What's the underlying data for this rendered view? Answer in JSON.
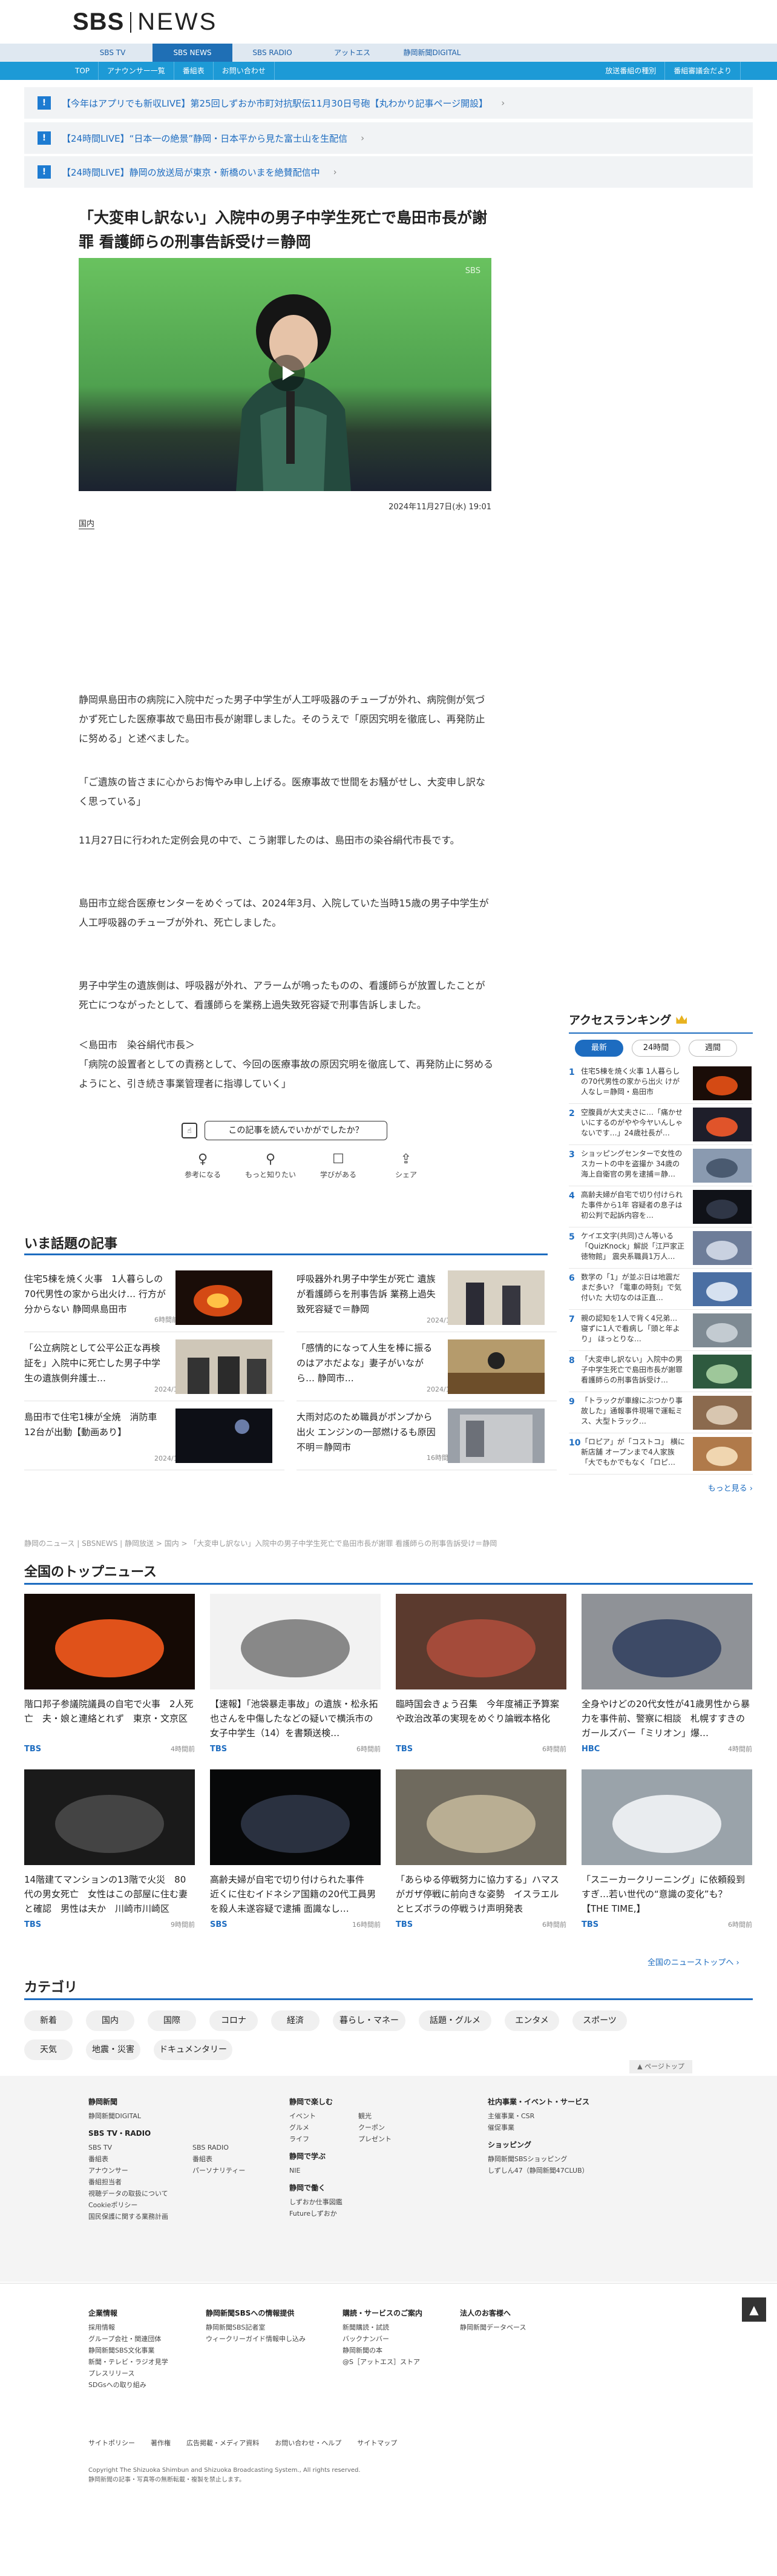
{
  "logo": {
    "sbs": "SBS",
    "news": "NEWS"
  },
  "nav1": [
    "SBS TV",
    "SBS NEWS",
    "SBS RADIO",
    "アットエス",
    "静岡新聞DIGITAL"
  ],
  "nav2_left": [
    "TOP",
    "アナウンサー一覧",
    "番組表",
    "お問い合わせ"
  ],
  "nav2_right": [
    "放送番組の種別",
    "番組審議会だより"
  ],
  "alerts": [
    "【今年はアプリでも新収LIVE】第25回しずおか市町対抗駅伝11月30日号砲【丸わかり記事ページ開設】",
    "【24時間LIVE】“日本一の絶景”静岡・日本平から見た富士山を生配信",
    "【24時間LIVE】静岡の放送局が東京・新橋のいまを絶賛配信中"
  ],
  "article": {
    "title": "「大変申し訳ない」入院中の男子中学生死亡で島田市長が謝罪 看護師らの刑事告訴受け＝静岡",
    "video_mark": "SBS",
    "date": "2024年11月27日(水) 19:01",
    "category": "国内",
    "paragraphs": [
      "静岡県島田市の病院に入院中だった男子中学生が人工呼吸器のチューブが外れ、病院側が気づかず死亡した医療事故で島田市長が謝罪しました。そのうえで「原因究明を徹底し、再発防止に努める」と述べました。",
      "「ご遺族の皆さまに心からお悔やみ申し上げる。医療事故で世間をお騒がせし、大変申し訳なく思っている」",
      "11月27日に行われた定例会見の中で、こう謝罪したのは、島田市の染谷絹代市長です。",
      "島田市立総合医療センターをめぐっては、2024年3月、入院していた当時15歳の男子中学生が人工呼吸器のチューブが外れ、死亡しました。",
      "男子中学生の遺族側は、呼吸器が外れ、アラームが鳴ったものの、看護師らが放置したことが死亡につながったとして、看護師らを業務上過失致死容疑で刑事告訴しました。",
      "＜島田市　染谷絹代市長＞",
      "「病院の設置者としての責務として、今回の医療事故の原因究明を徹底して、再発防止に努めるようにと、引き続き事業管理者に指導していく」"
    ],
    "reaction_question": "この記事を読んでいかがでしたか？",
    "reactions": [
      "参考になる",
      "もっと知りたい",
      "学びがある",
      "シェア"
    ]
  },
  "hot": {
    "title": "いま話題の記事",
    "items": [
      {
        "title": "住宅5棟を焼く火事　1人暮らしの70代男性の家から出火け… 行方が分からない 静岡県島田市",
        "time": "6時間前"
      },
      {
        "title": "呼吸器外れ男子中学生が死亡 遺族が看護師らを刑事告訴 業務上過失致死容疑で＝静岡",
        "time": "2024/11/26"
      },
      {
        "title": "「公立病院として公平公正な再検証を」入院中に死亡した男子中学生の遺族側弁護士…",
        "time": "2024/11/18"
      },
      {
        "title": "「感情的になって人生を棒に振るのはアホだよな」妻子がいながら… 静岡市…",
        "time": "2024/10/10"
      },
      {
        "title": "島田市で住宅1棟が全焼　消防車12台が出動【動画あり】",
        "time": "2024/11/10"
      },
      {
        "title": "大雨対応のため職員がポンプから出火 エンジンの一部燃けるも原因不明＝静岡市",
        "time": "16時間前"
      }
    ]
  },
  "breadcrumb": "静岡のニュース | SBSNEWS | 静岡放送 > 国内 > 「大変申し訳ない」入院中の男子中学生死亡で島田市長が謝罪 看護師らの刑事告訴受け＝静岡",
  "ranking": {
    "title": "アクセスランキング",
    "tabs": [
      "最新",
      "24時間",
      "週間"
    ],
    "items": [
      "住宅5棟を焼く火事 1人暮らしの70代男性の家から出火 けが人なし＝静岡・島田市",
      "空腹員が大丈夫さに…「痛かせいにするのがやや今ヤいんしゃないです…」24歳社長が…",
      "ショッピングセンターで女性のスカートの中を盗撮か 34歳の海上自衛官の男を逮捕＝静…",
      "高齢夫婦が自宅で切り付けられた事件から1年 容疑者の息子は初公判で起訴内容を…",
      "ケイエ文字(共同)さん等いる「QuizKnock」解説「江戸家正徳物館」 震央系職員1万人…",
      "数学の「1」が並ぶ日は地震だまだ多い? 「電車の時刻」で気付いた 大切なのは正直…",
      "親の認知を1人で背く4兄弟… 寝ずに1人で看病し「頭と年より」 ほっとりな…",
      "「大変申し訳ない」入院中の男子中学生死亡で島田市長が謝罪 看護師らの刑事告訴受け…",
      "「トラックが車線にぶつかり事故した」通報事件現場で運転ミス、大型トラック…",
      "「ロピア」が「コストコ」 横に新店舗 オープンまで4人家族「大でもかでもなく「ロピ…"
    ],
    "more": "もっと見る ›"
  },
  "topnews": {
    "title": "全国のトップニュース",
    "items": [
      {
        "title": "階口邦子参議院議員の自宅で火事　2人死亡　夫・娘と連絡とれず　東京・文京区",
        "src": "TBS",
        "time": "4時間前"
      },
      {
        "title": "【速報】「池袋暴走事故」の遺族・松永拓也さんを中傷したなどの疑いで横浜市の女子中学生（14）を書類送検…",
        "src": "TBS",
        "time": "6時間前"
      },
      {
        "title": "臨時国会きょう召集　今年度補正予算案や政治改革の実現をめぐり論戦本格化",
        "src": "TBS",
        "time": "6時間前"
      },
      {
        "title": "全身やけどの20代女性が41歳男性から暴力を事件前、警察に相談　札幌すすきのガールズバー「ミリオン」爆…",
        "src": "HBC",
        "time": "4時間前"
      },
      {
        "title": "14階建てマンションの13階で火災　80代の男女死亡　女性はこの部屋に住む妻と確認　男性は夫か　川崎市川崎区",
        "src": "TBS",
        "time": "9時間前"
      },
      {
        "title": "高齢夫婦が自宅で切り付けられた事件　近くに住むイドネシア国籍の20代工員男を殺人未遂容疑で逮捕 面識なし…",
        "src": "SBS",
        "time": "16時間前"
      },
      {
        "title": "「あらゆる停戦努力に協力する」ハマスがガザ停戦に前向きな姿勢　イスラエルとヒズボラの停戦うけ声明発表",
        "src": "TBS",
        "time": "6時間前"
      },
      {
        "title": "「スニーカークリーニング」に依頼殺到すぎ…若い世代の“意識の変化”も？【THE TIME,】",
        "src": "TBS",
        "time": "6時間前"
      }
    ],
    "more": "全国のニューストップへ ›"
  },
  "categories": {
    "title": "カテゴリ",
    "items": [
      "新着",
      "国内",
      "国際",
      "コロナ",
      "経済",
      "暮らし・マネー",
      "話題・グルメ",
      "エンタメ",
      "スポーツ",
      "天気",
      "地震・災害",
      "ドキュメンタリー"
    ]
  },
  "pagetop": "▲ ページトップ",
  "footer": {
    "col1": {
      "head": "静岡新聞",
      "items": [
        "静岡新聞DIGITAL"
      ],
      "head2": "SBS TV・RADIO",
      "tv_head": "SBS TV",
      "tv": [
        "番組表",
        "アナウンサー",
        "番組担当者",
        "視聴データの取扱について",
        "Cookieポリシー",
        "国民保護に関する業務計画"
      ],
      "radio_head": "SBS RADIO",
      "radio": [
        "番組表",
        "パーソナリティー"
      ]
    },
    "col2": {
      "head": "静岡で楽しむ",
      "items_a": [
        "イベント",
        "グルメ",
        "ライフ"
      ],
      "items_b": [
        "観光",
        "クーポン",
        "プレゼント"
      ],
      "head2": "静岡で学ぶ",
      "learn": [
        "NIE"
      ],
      "head3": "静岡で働く",
      "work": [
        "しずおか仕事図鑑",
        "Futureしずおか"
      ]
    },
    "col3": {
      "head": "社内事業・イベント・サービス",
      "items": [
        "主催事業・CSR",
        "催促事業"
      ],
      "head2": "ショッピング",
      "shop": [
        "静岡新聞SBSショッピング",
        "しずしん47（静岡新聞47CLUB）"
      ]
    },
    "corp": {
      "head": "企業情報",
      "items": [
        "採用情報",
        "グループ会社・関連団体",
        "静岡新聞SBS文化事業",
        "新聞・テレビ・ラジオ見学",
        "プレスリリース",
        "SDGsへの取り組み"
      ]
    },
    "info": {
      "head": "静岡新聞SBSへの情報提供",
      "items": [
        "静岡新聞SBS記者室",
        "ウィークリーガイド情報申し込み"
      ]
    },
    "sub": {
      "head": "購読・サービスのご案内",
      "items": [
        "新聞購読・試読",
        "バックナンバー",
        "静岡新聞の本",
        "@S［アットエス］ストア"
      ]
    },
    "corp2": {
      "head": "法人のお客様へ",
      "items": [
        "静岡新聞データベース"
      ]
    },
    "links": [
      "サイトポリシー",
      "著作権",
      "広告掲載・メディア資料",
      "お問い合わせ・ヘルプ",
      "サイトマップ"
    ],
    "copy1": "Copyright The Shizuoka Shimbun and Shizuoka Broadcasting System., All rights reserved.",
    "copy2": "静岡新聞の記事・写真等の無断転載・複製を禁止します。"
  },
  "totop": "▲"
}
